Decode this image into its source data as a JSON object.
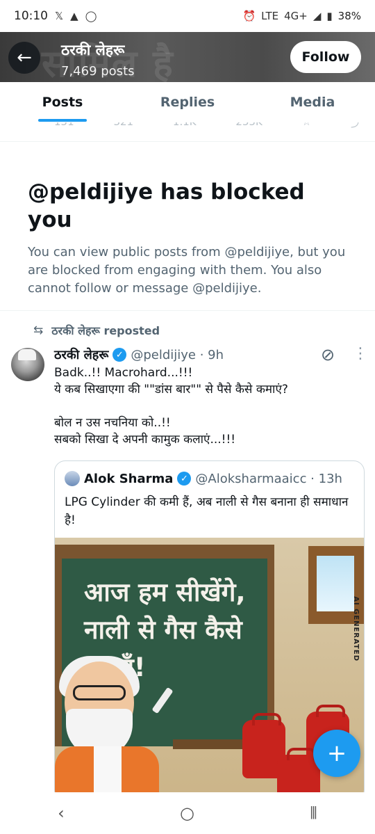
{
  "status_bar": {
    "time": "10:10",
    "left_icons": [
      "x-logo-icon",
      "app-notification-icon",
      "circle-app-icon"
    ],
    "network": "4G+",
    "lte_label": "LTE",
    "battery": "38%"
  },
  "header": {
    "profile_name": "ठरकी लेहरू",
    "posts_count": "7,469 posts",
    "follow_label": "Follow",
    "banner_text": "सामिल है"
  },
  "tabs": [
    {
      "label": "Posts",
      "active": true
    },
    {
      "label": "Replies",
      "active": false
    },
    {
      "label": "Media",
      "active": false
    }
  ],
  "faded_actions": [
    "151",
    "321",
    "1.1K",
    "255K"
  ],
  "blocked": {
    "title": "@peldijiye has blocked you",
    "message": "You can view public posts from @peldijiye, but you are blocked from engaging with them. You also cannot follow or message @peldijiye."
  },
  "repost": {
    "label": "ठरकी लेहरू reposted"
  },
  "tweet": {
    "author_name": "ठरकी लेहरू",
    "handle_time": "@peldijiye · 9h",
    "text": "Badk..!! Macrohard...!!!\nये कब सिखाएगा की \"\"डांस बार\"\" से पैसे कैसे कमाएं?\n\nबोल न उस नचनिया को..!!\nसबको सिखा दे अपनी कामुक कलाएं...!!!"
  },
  "quote": {
    "author_name": "Alok Sharma",
    "handle_time": "@Aloksharmaaicc · 13h",
    "text": "LPG Cylinder की कमी हैं, अब नाली से गैस बनाना ही समाधान है!",
    "image_text": "आज हम सीखेंगे, नाली से गैस कैसे बनाएँ!",
    "image_tag": "AI GENERATED"
  },
  "fab_label": "+",
  "colors": {
    "accent": "#1d9bf0",
    "secondary_text": "#536471",
    "board_green": "#2f5a45",
    "cylinder_red": "#c8231d"
  }
}
